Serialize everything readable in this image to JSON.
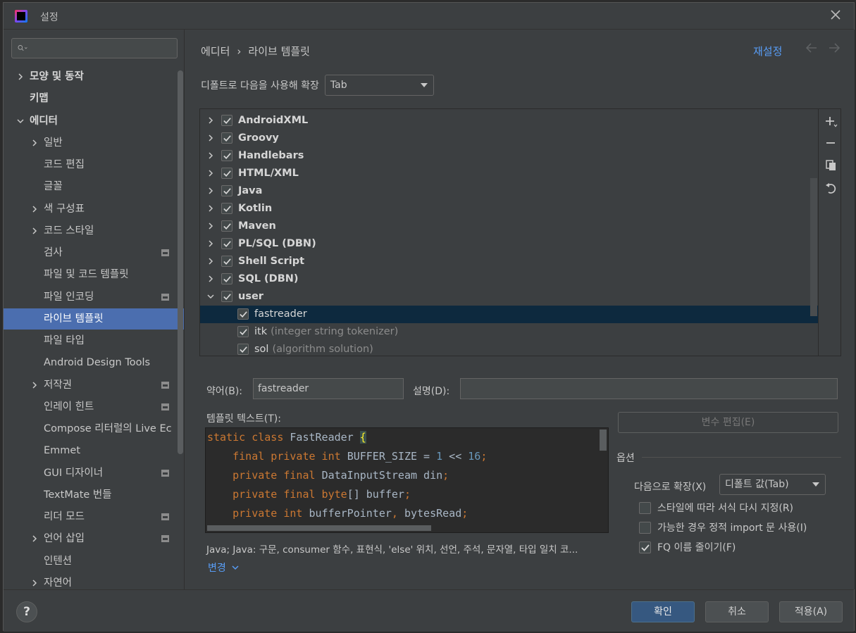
{
  "dialog": {
    "title": "설정",
    "close_icon": "close-icon"
  },
  "search": {
    "placeholder": "",
    "icon": "search-icon"
  },
  "sidebar": {
    "items": [
      {
        "label": "모양 및 동작",
        "expandable": true,
        "expanded": false,
        "level": 0,
        "bold": true
      },
      {
        "label": "키맵",
        "expandable": false,
        "level": 0,
        "bold": true
      },
      {
        "label": "에디터",
        "expandable": true,
        "expanded": true,
        "level": 0,
        "bold": true
      },
      {
        "label": "일반",
        "expandable": true,
        "expanded": false,
        "level": 1
      },
      {
        "label": "코드 편집",
        "expandable": false,
        "level": 1
      },
      {
        "label": "글꼴",
        "expandable": false,
        "level": 1
      },
      {
        "label": "색 구성표",
        "expandable": true,
        "expanded": false,
        "level": 1
      },
      {
        "label": "코드 스타일",
        "expandable": true,
        "expanded": false,
        "level": 1
      },
      {
        "label": "검사",
        "expandable": false,
        "level": 1,
        "project_icon": true
      },
      {
        "label": "파일 및 코드 템플릿",
        "expandable": false,
        "level": 1
      },
      {
        "label": "파일 인코딩",
        "expandable": false,
        "level": 1,
        "project_icon": true
      },
      {
        "label": "라이브 템플릿",
        "expandable": false,
        "level": 1,
        "selected": true
      },
      {
        "label": "파일 타입",
        "expandable": false,
        "level": 1
      },
      {
        "label": "Android Design Tools",
        "expandable": false,
        "level": 1
      },
      {
        "label": "저작권",
        "expandable": true,
        "expanded": false,
        "level": 1,
        "project_icon": true
      },
      {
        "label": "인레이 힌트",
        "expandable": false,
        "level": 1,
        "project_icon": true
      },
      {
        "label": "Compose 리터럴의 Live Ec",
        "expandable": false,
        "level": 1
      },
      {
        "label": "Emmet",
        "expandable": false,
        "level": 1
      },
      {
        "label": "GUI 디자이너",
        "expandable": false,
        "level": 1,
        "project_icon": true
      },
      {
        "label": "TextMate 번들",
        "expandable": false,
        "level": 1
      },
      {
        "label": "리더 모드",
        "expandable": false,
        "level": 1,
        "project_icon": true
      },
      {
        "label": "언어 삽입",
        "expandable": true,
        "expanded": false,
        "level": 1,
        "project_icon": true
      },
      {
        "label": "인텐션",
        "expandable": false,
        "level": 1
      },
      {
        "label": "자연어",
        "expandable": true,
        "expanded": false,
        "level": 1
      }
    ]
  },
  "header": {
    "breadcrumb_parent": "에디터",
    "breadcrumb_sep": "›",
    "breadcrumb_current": "라이브 템플릿",
    "reset_label": "재설정",
    "back_icon": "arrow-left-icon",
    "forward_icon": "arrow-right-icon"
  },
  "expand_default": {
    "label": "디폴트로 다음을 사용해 확장",
    "value": "Tab"
  },
  "templates": [
    {
      "name": "AndroidXML",
      "type": "group",
      "checked": true,
      "expanded": false
    },
    {
      "name": "Groovy",
      "type": "group",
      "checked": true,
      "expanded": false
    },
    {
      "name": "Handlebars",
      "type": "group",
      "checked": true,
      "expanded": false
    },
    {
      "name": "HTML/XML",
      "type": "group",
      "checked": true,
      "expanded": false
    },
    {
      "name": "Java",
      "type": "group",
      "checked": true,
      "expanded": false
    },
    {
      "name": "Kotlin",
      "type": "group",
      "checked": true,
      "expanded": false
    },
    {
      "name": "Maven",
      "type": "group",
      "checked": true,
      "expanded": false
    },
    {
      "name": "PL/SQL (DBN)",
      "type": "group",
      "checked": true,
      "expanded": false
    },
    {
      "name": "Shell Script",
      "type": "group",
      "checked": true,
      "expanded": false
    },
    {
      "name": "SQL (DBN)",
      "type": "group",
      "checked": true,
      "expanded": false
    },
    {
      "name": "user",
      "type": "group",
      "checked": true,
      "expanded": true
    },
    {
      "name": "fastreader",
      "type": "item",
      "checked": true,
      "desc": "",
      "selected": true
    },
    {
      "name": "itk",
      "type": "item",
      "checked": true,
      "desc": "(integer string tokenizer)"
    },
    {
      "name": "sol",
      "type": "item",
      "checked": true,
      "desc": "(algorithm solution)"
    }
  ],
  "toolbar": {
    "add_icon": "add-icon",
    "remove_icon": "minus-icon",
    "copy_icon": "copy-icon",
    "restore_icon": "undo-icon"
  },
  "editor": {
    "abbr_label": "약어(B):",
    "abbr_value": "fastreader",
    "desc_label": "설명(D):",
    "desc_value": "",
    "template_text_label": "템플릿 텍스트(T):",
    "edit_vars_label": "변수 편집(E)",
    "context_text": "Java; Java: 구문, consumer 함수, 표현식, 'else' 위치, 선언, 주석, 문자열, 타입 일치 코...",
    "change_label": "변경"
  },
  "code_lines": [
    "static class FastReader {",
    "    final private int BUFFER_SIZE = 1 << 16;",
    "    private final DataInputStream din;",
    "    private final byte[] buffer;",
    "    private int bufferPointer, bytesRead;"
  ],
  "options": {
    "title": "옵션",
    "expand_with_label": "다음으로 확장(X)",
    "expand_with_value": "디폴트 값(Tab)",
    "reformat_label": "스타일에 따라 서식 다시 지정(R)",
    "reformat_checked": false,
    "static_import_label": "가능한 경우 정적 import 문 사용(I)",
    "static_import_checked": false,
    "shorten_fq_label": "FQ 이름 줄이기(F)",
    "shorten_fq_checked": true
  },
  "footer": {
    "help_label": "?",
    "ok_label": "확인",
    "cancel_label": "취소",
    "apply_label": "적용(A)"
  },
  "colors": {
    "accent": "#589df6",
    "selection": "#4b6eaf",
    "primary_button": "#365880",
    "keyword": "#cc7832",
    "number": "#6897bb"
  }
}
